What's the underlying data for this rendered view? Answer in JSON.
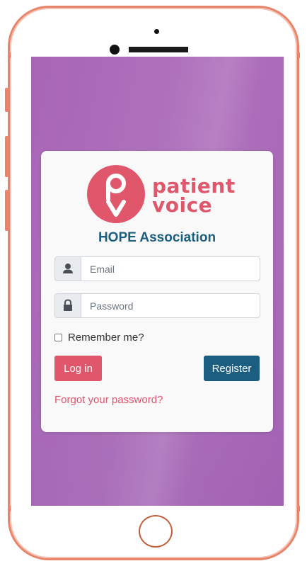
{
  "logo": {
    "line1": "patient",
    "line2": "voice",
    "monogram": "pv"
  },
  "org_name": "HOPE Association",
  "form": {
    "email_placeholder": "Email",
    "password_placeholder": "Password",
    "remember_label": "Remember me?",
    "login_label": "Log in",
    "register_label": "Register",
    "forgot_label": "Forgot your password?"
  },
  "icons": {
    "user": "user-icon",
    "lock": "lock-icon"
  },
  "colors": {
    "brand_pink": "#e0566a",
    "brand_blue": "#1b5e80",
    "screen_purple": "#a865b6",
    "phone_frame": "#e8846a"
  }
}
